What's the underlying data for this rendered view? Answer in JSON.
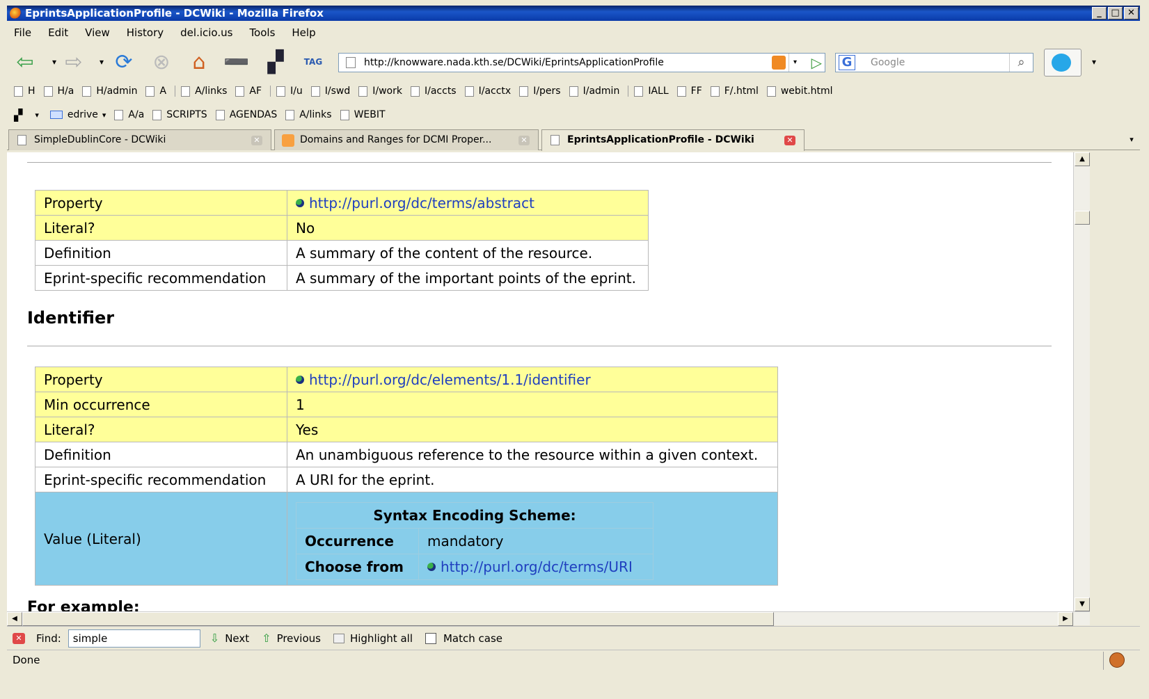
{
  "window": {
    "title": "EprintsApplicationProfile - DCWiki - Mozilla Firefox",
    "controls": [
      "_",
      "□",
      "✕"
    ]
  },
  "menu": [
    "File",
    "Edit",
    "View",
    "History",
    "del.icio.us",
    "Tools",
    "Help"
  ],
  "nav": {
    "url": "http://knowware.nada.kth.se/DCWiki/EprintsApplicationProfile",
    "search_placeholder": "Google",
    "tag_label": "TAG"
  },
  "bookmarks_row1": [
    "H",
    "H/a",
    "H/admin",
    "A",
    "A/links",
    "AF",
    "I/u",
    "I/swd",
    "I/work",
    "I/accts",
    "I/acctx",
    "I/pers",
    "I/admin",
    "IALL",
    "FF",
    "F/.html",
    "webit.html"
  ],
  "bookmarks_row2": [
    "edrive",
    "A/a",
    "SCRIPTS",
    "AGENDAS",
    "A/links",
    "WEBIT"
  ],
  "tabs": [
    {
      "label": "SimpleDublinCore - DCWiki"
    },
    {
      "label": "Domains and Ranges for DCMI Proper..."
    },
    {
      "label": "EprintsApplicationProfile - DCWiki"
    }
  ],
  "table1": {
    "rows": [
      {
        "key": "Property",
        "value": "http://purl.org/dc/terms/abstract",
        "link": true,
        "style": "yellow"
      },
      {
        "key": "Literal?",
        "value": "No",
        "style": "yellow"
      },
      {
        "key": "Definition",
        "value": "A summary of the content of the resource.",
        "style": "white"
      },
      {
        "key": "Eprint-specific recommendation",
        "value": "A summary of the important points of the eprint.",
        "style": "white"
      }
    ]
  },
  "section2": {
    "heading": "Identifier"
  },
  "table2": {
    "rows": [
      {
        "key": "Property",
        "value": "http://purl.org/dc/elements/1.1/identifier",
        "link": true,
        "style": "yellow"
      },
      {
        "key": "Min occurrence",
        "value": "1",
        "style": "yellow"
      },
      {
        "key": "Literal?",
        "value": "Yes",
        "style": "yellow"
      },
      {
        "key": "Definition",
        "value": "An unambiguous reference to the resource within a given context.",
        "style": "white"
      },
      {
        "key": "Eprint-specific recommendation",
        "value": "A URI for the eprint.",
        "style": "white"
      }
    ],
    "value_row": {
      "key": "Value (Literal)",
      "ses_title": "Syntax Encoding Scheme:",
      "occurrence_label": "Occurrence",
      "occurrence_value": "mandatory",
      "choose_label": "Choose from",
      "choose_value": "http://purl.org/dc/terms/URI"
    }
  },
  "section3": {
    "heading": "For example:"
  },
  "findbar": {
    "label": "Find:",
    "value": "simple",
    "next": "Next",
    "previous": "Previous",
    "highlight": "Highlight all",
    "match_case": "Match case"
  },
  "status": {
    "text": "Done"
  },
  "colors": {
    "title_bar": "#0a246a",
    "yellow_row": "#ffff99",
    "blue_row": "#87cdea",
    "link": "#1f3fbf"
  }
}
